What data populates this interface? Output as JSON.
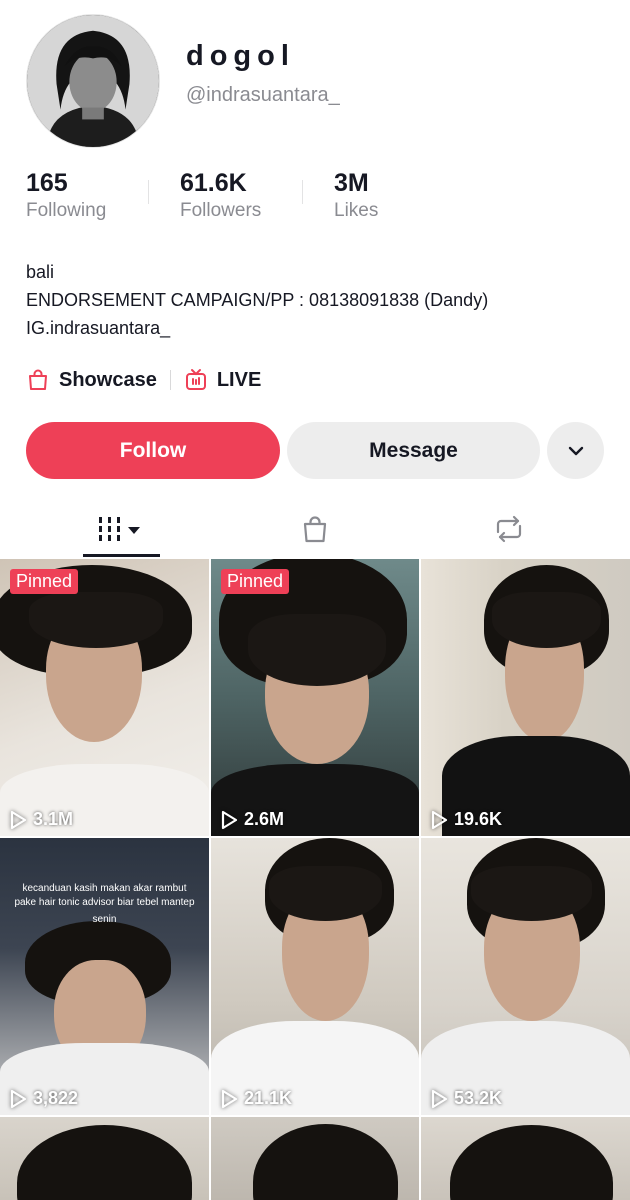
{
  "profile": {
    "display_name": "dogol",
    "username": "@indrasuantara_"
  },
  "stats": [
    {
      "value": "165",
      "label": "Following"
    },
    {
      "value": "61.6K",
      "label": "Followers"
    },
    {
      "value": "3M",
      "label": "Likes"
    }
  ],
  "bio": {
    "lines": [
      "bali",
      "ENDORSEMENT CAMPAIGN/PP : 08138091838 (Dandy)",
      "IG.indrasuantara_"
    ]
  },
  "links": {
    "showcase": "Showcase",
    "live": "LIVE"
  },
  "actions": {
    "follow": "Follow",
    "message": "Message"
  },
  "tabs": [
    "videos-icon",
    "shopping-bag-icon",
    "repost-icon"
  ],
  "colors": {
    "accent": "#ee4057",
    "secondary_button": "#ededed",
    "muted_text": "#8a8b91"
  },
  "videos": [
    {
      "pinned": "Pinned",
      "views": "3.1M"
    },
    {
      "pinned": "Pinned",
      "views": "2.6M"
    },
    {
      "pinned": "",
      "views": "19.6K"
    },
    {
      "pinned": "",
      "views": "3,822",
      "overlay": "kecanduan kasih makan akar rambut pake hair tonic advisor biar tebel mantep",
      "overlay_sub": "senin"
    },
    {
      "pinned": "",
      "views": "21.1K"
    },
    {
      "pinned": "",
      "views": "53.2K"
    },
    {
      "pinned": "",
      "views": ""
    },
    {
      "pinned": "",
      "views": ""
    },
    {
      "pinned": "",
      "views": ""
    }
  ]
}
